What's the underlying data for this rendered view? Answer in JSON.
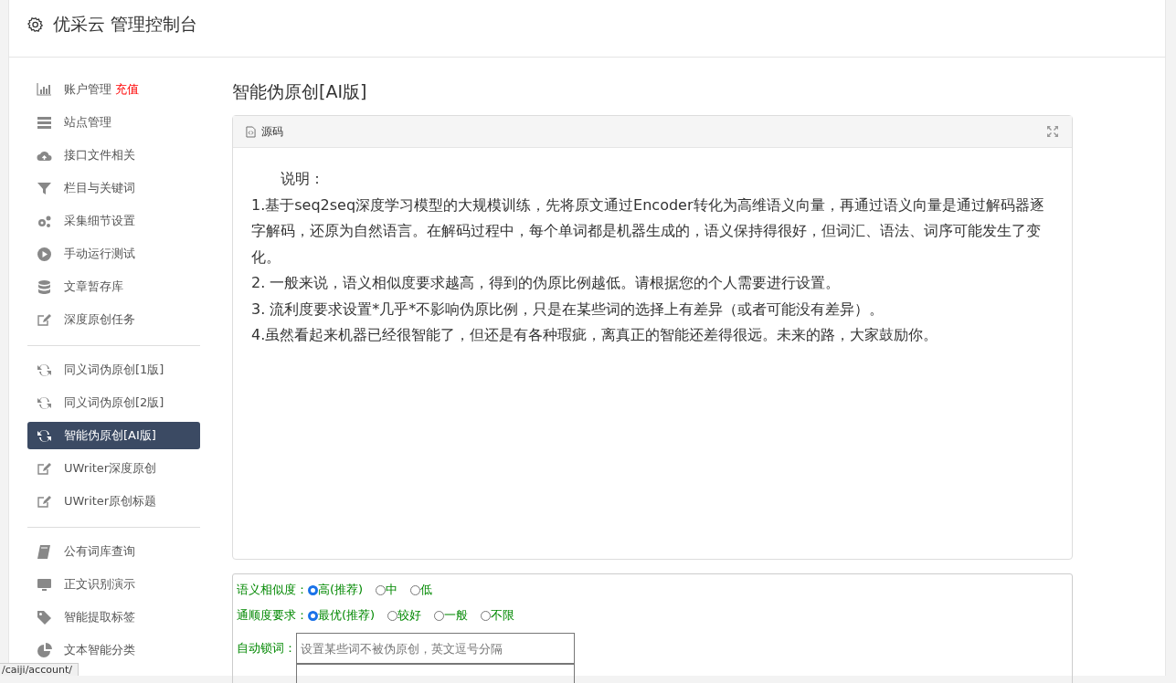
{
  "header": {
    "title": "优采云 管理控制台"
  },
  "sidebar": {
    "groups": [
      {
        "items": [
          {
            "label": "账户管理",
            "badge": "充值",
            "selected": false
          },
          {
            "label": "站点管理",
            "selected": false
          },
          {
            "label": "接口文件相关",
            "selected": false
          },
          {
            "label": "栏目与关键词",
            "selected": false
          },
          {
            "label": "采集细节设置",
            "selected": false
          },
          {
            "label": "手动运行测试",
            "selected": false
          },
          {
            "label": "文章暂存库",
            "selected": false
          },
          {
            "label": "深度原创任务",
            "selected": false
          }
        ]
      },
      {
        "items": [
          {
            "label": "同义词伪原创[1版]",
            "selected": false
          },
          {
            "label": "同义词伪原创[2版]",
            "selected": false
          },
          {
            "label": "智能伪原创[AI版]",
            "selected": true
          },
          {
            "label": "UWriter深度原创",
            "selected": false
          },
          {
            "label": "UWriter原创标题",
            "selected": false
          }
        ]
      },
      {
        "items": [
          {
            "label": "公有词库查询",
            "selected": false
          },
          {
            "label": "正文识别演示",
            "selected": false
          },
          {
            "label": "智能提取标签",
            "selected": false
          },
          {
            "label": "文本智能分类",
            "selected": false
          }
        ]
      }
    ]
  },
  "page_title": "智能伪原创[AI版]",
  "editor": {
    "toolbar_label": "源码",
    "lines": [
      "说明：",
      "1.基于seq2seq深度学习模型的大规模训练，先将原文通过Encoder转化为高维语义向量，再通过语义向量是通过解码器逐字解码，还原为自然语言。在解码过程中，每个单词都是机器生成的，语义保持得很好，但词汇、语法、词序可能发生了变化。",
      "2. 一般来说，语义相似度要求越高，得到的伪原比例越低。请根据您的个人需要进行设置。",
      "3. 流利度要求设置*几乎*不影响伪原比例，只是在某些词的选择上有差异（或者可能没有差异）。",
      "4.虽然看起来机器已经很智能了，但还是有各种瑕疵，离真正的智能还差得很远。未来的路，大家鼓励你。"
    ]
  },
  "options": [
    {
      "label": "语义相似度：",
      "choices": [
        {
          "text": "高(推荐)",
          "selected": true
        },
        {
          "text": "中",
          "selected": false
        },
        {
          "text": "低",
          "selected": false
        }
      ]
    },
    {
      "label": "通顺度要求：",
      "choices": [
        {
          "text": "最优(推荐)",
          "selected": true
        },
        {
          "text": "较好",
          "selected": false
        },
        {
          "text": "一般",
          "selected": false
        },
        {
          "text": "不限",
          "selected": false
        }
      ]
    }
  ],
  "lock_words": {
    "label": "自动锁词：",
    "placeholder": "设置某些词不被伪原创，英文逗号分隔"
  },
  "status_url": "/caiji/account/"
}
